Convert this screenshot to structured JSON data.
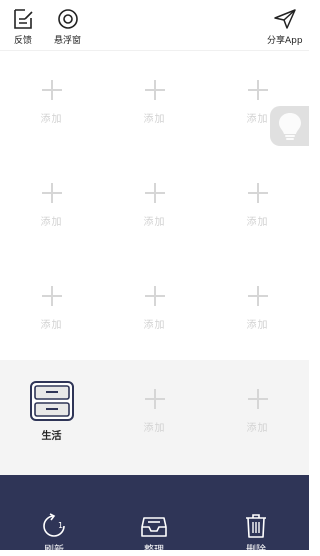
{
  "toolbar": {
    "feedback_label": "反馈",
    "float_window_label": "悬浮窗",
    "share_label": "分享App"
  },
  "grid": {
    "slots": [
      {
        "label": "添加"
      },
      {
        "label": "添加"
      },
      {
        "label": "添加"
      },
      {
        "label": "添加"
      },
      {
        "label": "添加"
      },
      {
        "label": "添加"
      },
      {
        "label": "添加"
      },
      {
        "label": "添加"
      },
      {
        "label": "添加"
      }
    ]
  },
  "dock": {
    "life_label": "生活",
    "slots": [
      {
        "label": "添加"
      },
      {
        "label": "添加"
      }
    ]
  },
  "bottom": {
    "refresh_label": "刷新",
    "organize_label": "整理",
    "delete_label": "删除"
  },
  "colors": {
    "bottom_bar": "#2f3557",
    "dock_bg": "#f4f4f4",
    "placeholder": "#d6d6d6"
  }
}
